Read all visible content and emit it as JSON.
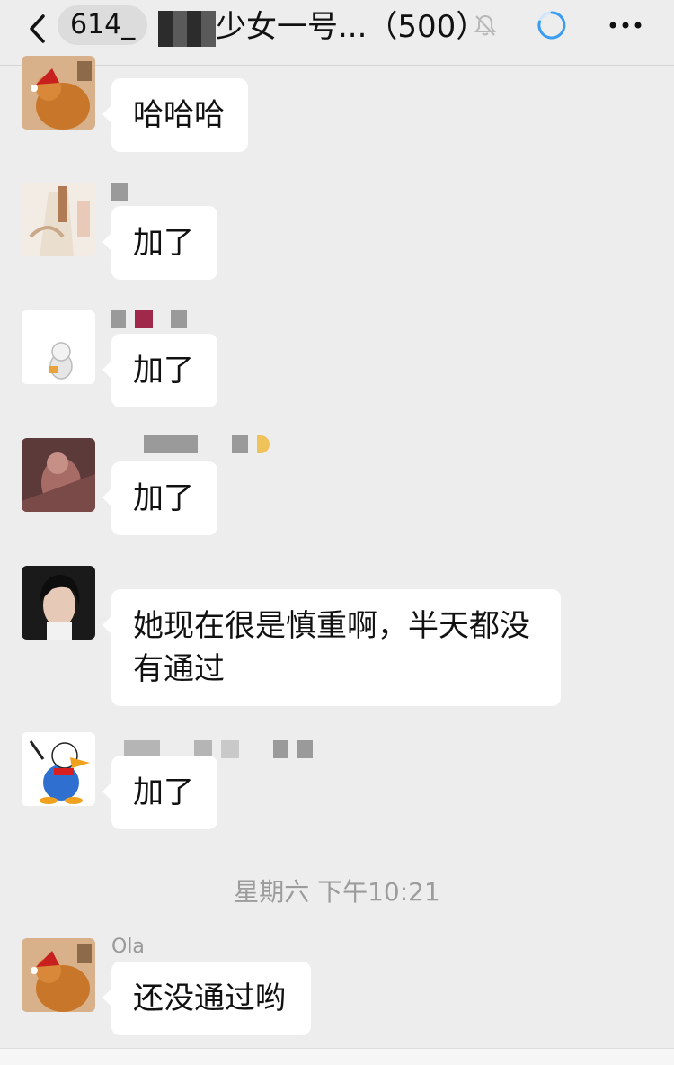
{
  "navbar": {
    "unread_count": "614_",
    "title": "少女一号...（500）"
  },
  "messages": [
    {
      "text": "哈哈哈"
    },
    {
      "text": "加了"
    },
    {
      "text": "加了"
    },
    {
      "text": "加了"
    },
    {
      "text": "她现在很是慎重啊，半天都没有通过"
    },
    {
      "text": "加了"
    },
    {
      "text": "还没通过哟"
    }
  ],
  "timestamp": "星期六 下午10:21",
  "last_sender_nickname": "Ola",
  "icons": {
    "back": "chevron-left-icon",
    "mute": "bell-slash-icon",
    "loading": "loading-spinner-icon",
    "more": "more-dots-icon"
  },
  "colors": {
    "background": "#ededed",
    "bubble": "#ffffff",
    "spinner": "#3b9cf0"
  }
}
